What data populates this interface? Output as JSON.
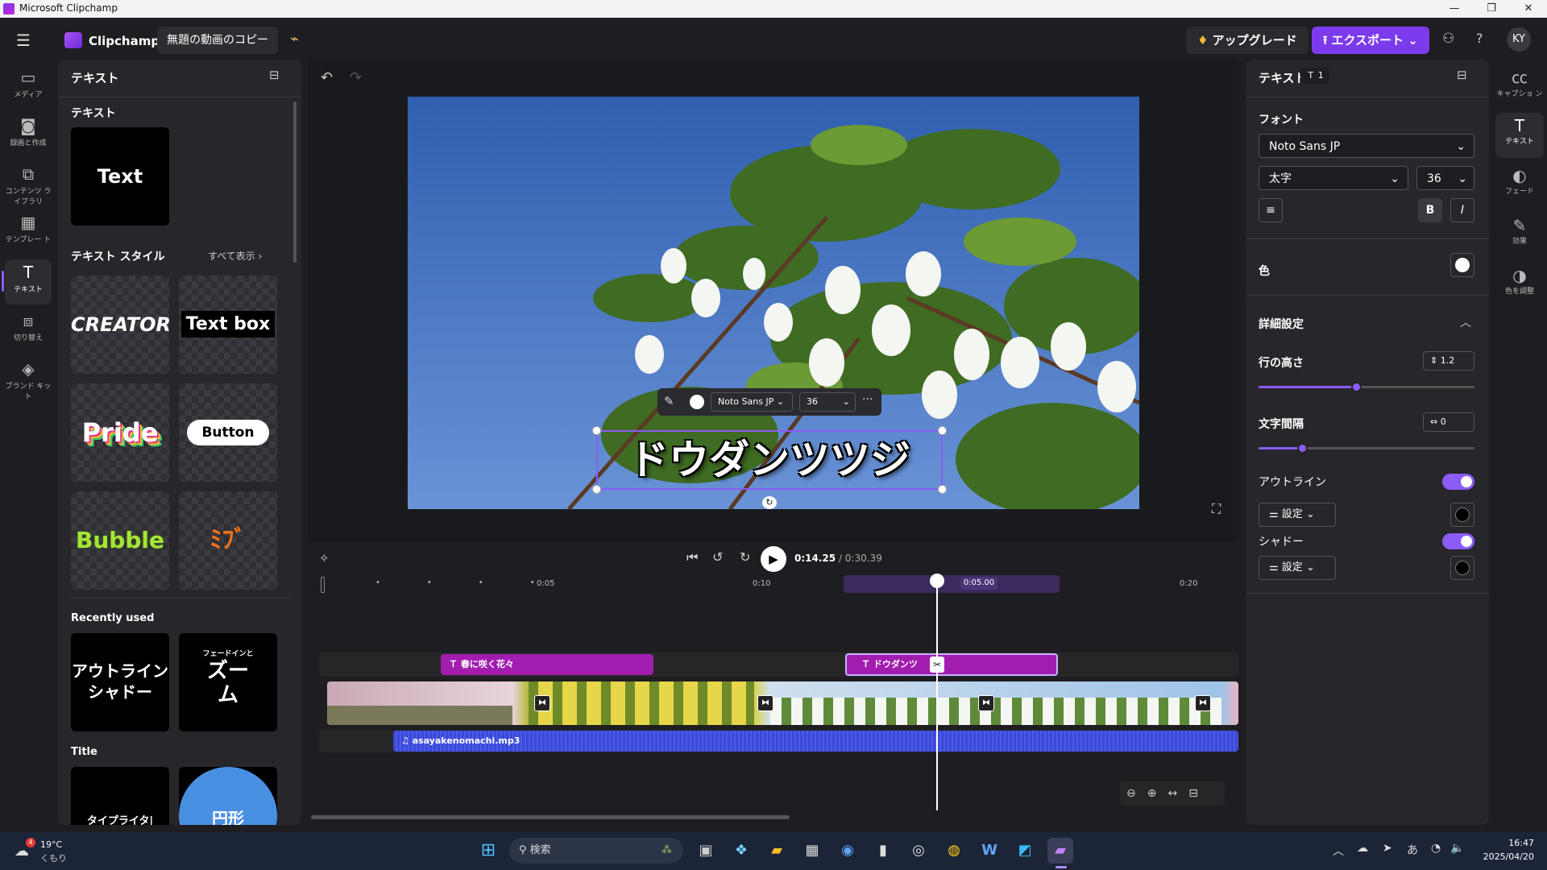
{
  "titlebar": {
    "title": "Microsoft Clipchamp",
    "min": "—",
    "max": "❐",
    "close": "✕"
  },
  "topbar": {
    "app_name": "Clipchamp",
    "project_name": "無題の動画のコピー",
    "upgrade_label": "アップグレード",
    "export_label": "エクスポート",
    "help": "?",
    "avatar": "KY"
  },
  "leftrail": [
    {
      "name": "media",
      "label": "メディア",
      "icon": "▭"
    },
    {
      "name": "record",
      "label": "録画と作成",
      "icon": "◙"
    },
    {
      "name": "content-library",
      "label": "コンテンツ ライブラリ",
      "icon": "⧉"
    },
    {
      "name": "templates",
      "label": "テンプレー ト",
      "icon": "▦"
    },
    {
      "name": "text",
      "label": "テキスト",
      "icon": "T"
    },
    {
      "name": "transitions",
      "label": "切り替え",
      "icon": "⧈"
    },
    {
      "name": "brand-kit",
      "label": "ブランド キット",
      "icon": "◈"
    }
  ],
  "leftpanel": {
    "header": "テキスト",
    "section_text": "テキスト",
    "text_tile": "Text",
    "styles_header": "テキスト スタイル",
    "show_all": "すべて表示",
    "styles": [
      "CREATOR",
      "Text box",
      "Pride",
      "Button",
      "Bubble",
      "ﾐﾌﾞ"
    ],
    "recent_header": "Recently used",
    "recent": [
      {
        "line1": "アウトライン",
        "line2": "シャドー"
      },
      {
        "small": "フェードインと",
        "line1": "ズー",
        "line2": "ム"
      }
    ],
    "title_header": "Title",
    "title_tiles": [
      "タイプライタ|",
      "円形"
    ]
  },
  "canvas": {
    "overlay_text": "ドウダンツツジ",
    "toolbar_font": "Noto Sans JP",
    "toolbar_size": "36",
    "more": "···"
  },
  "playback": {
    "current": "0:14.25",
    "total": "/ 0:30.39"
  },
  "ruler": {
    "labels": [
      "0:05",
      "0:10",
      "0:20"
    ],
    "marker": "0:05.00"
  },
  "tracks": {
    "text_clip_1": "春に咲く花々",
    "text_clip_2": "ドウダンツ",
    "audio_clip": "asayakenomachi.mp3"
  },
  "rightpanel": {
    "header": "テキスト",
    "count": "1",
    "font_label": "フォント",
    "font_value": "Noto Sans JP",
    "weight_value": "太字",
    "size_value": "36",
    "bold": "B",
    "italic": "I",
    "color_label": "色",
    "advanced_label": "詳細設定",
    "line_height_label": "行の高さ",
    "line_height_value": "1.2",
    "line_height_fraction": 0.45,
    "letter_spacing_label": "文字間隔",
    "letter_spacing_value": "0",
    "letter_spacing_fraction": 0.2,
    "outline_label": "アウトライン",
    "outline_settings": "設定",
    "shadow_label": "シャドー",
    "shadow_settings": "設定"
  },
  "rightrail": [
    {
      "name": "captions",
      "label": "キャプショ ン",
      "icon": "㏄"
    },
    {
      "name": "text",
      "label": "テキスト",
      "icon": "T"
    },
    {
      "name": "fade",
      "label": "フェード",
      "icon": "◐"
    },
    {
      "name": "effects",
      "label": "効果",
      "icon": "✎"
    },
    {
      "name": "color-adjust",
      "label": "色を調整",
      "icon": "◑"
    }
  ],
  "taskbar": {
    "weather_temp": "19°C",
    "weather_desc": "くもり",
    "weather_badge": "4",
    "search_label": "検索",
    "ime": "あ",
    "time": "16:47",
    "date": "2025/04/20"
  },
  "colors": {
    "accent": "#8b5cf6",
    "export": "#7c3aed",
    "text_clip": "#a21caf",
    "audio": "#3b49d8"
  }
}
